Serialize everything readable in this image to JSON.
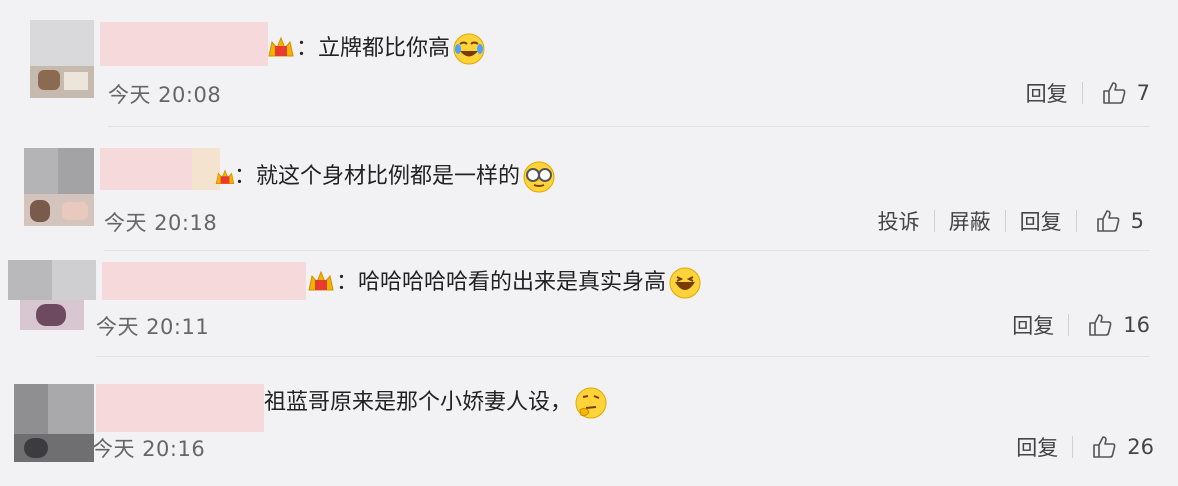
{
  "comments": [
    {
      "text": "：立牌都比你高",
      "time": "今天 20:08",
      "actions": [
        "回复"
      ],
      "likes": "7",
      "emoji": "cry-laugh-emoji"
    },
    {
      "text": "：就这个身材比例都是一样的",
      "time": "今天 20:18",
      "actions": [
        "投诉",
        "屏蔽",
        "回复"
      ],
      "likes": "5",
      "emoji": "glasses-emoji"
    },
    {
      "text": "：哈哈哈哈哈看的出来是真实身高",
      "time": "今天 20:11",
      "actions": [
        "回复"
      ],
      "likes": "16",
      "emoji": "laughing-emoji"
    },
    {
      "text": "祖蓝哥原来是那个小娇妻人设，",
      "time": "今天 20:16",
      "actions": [
        "回复"
      ],
      "likes": "26",
      "emoji": "thinking-emoji"
    }
  ],
  "colors": {
    "background": "#f2f2f5",
    "name_blur": "#f7d6d6",
    "badge": "#f0b400"
  }
}
